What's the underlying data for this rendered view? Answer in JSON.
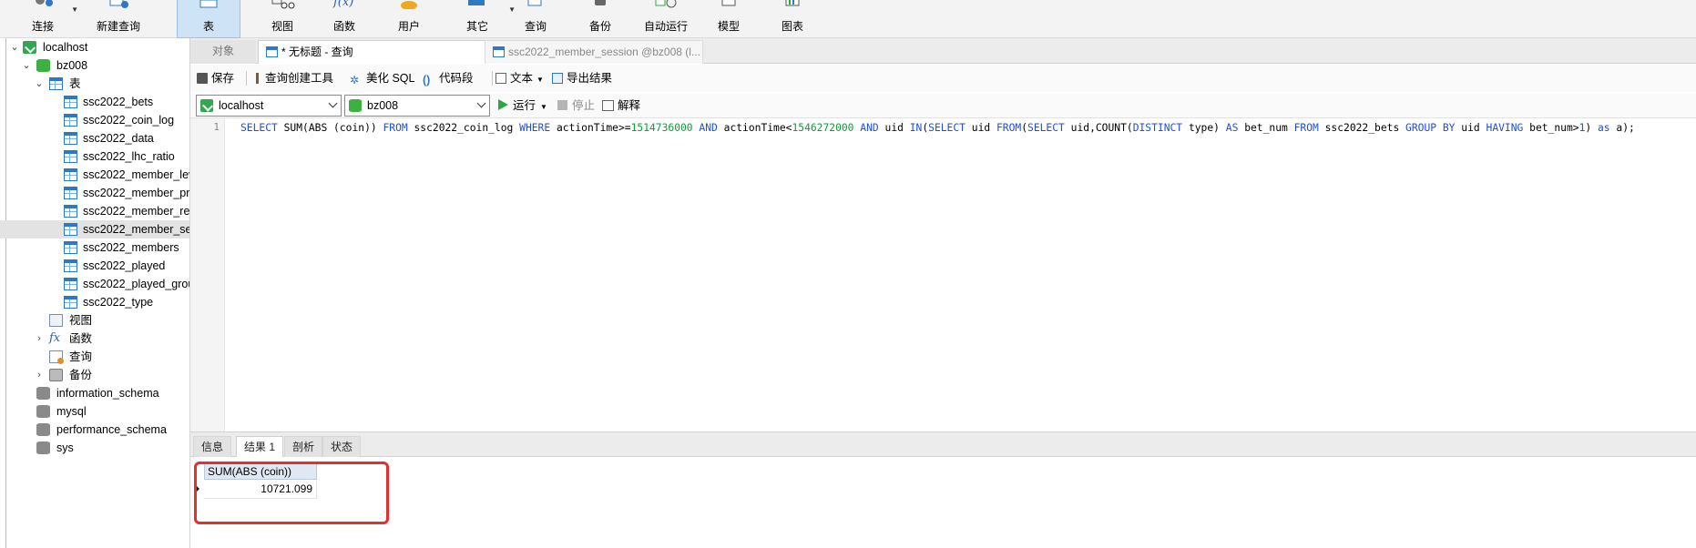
{
  "ribbon": {
    "items": [
      {
        "label": "连接",
        "icon": "plug-icon"
      },
      {
        "label": "新建查询",
        "icon": "new-query-icon"
      },
      {
        "label": "表",
        "icon": "table-icon"
      },
      {
        "label": "视图",
        "icon": "view-icon"
      },
      {
        "label": "函数",
        "icon": "function-icon"
      },
      {
        "label": "用户",
        "icon": "user-icon"
      },
      {
        "label": "其它",
        "icon": "other-icon"
      },
      {
        "label": "查询",
        "icon": "query-icon"
      },
      {
        "label": "备份",
        "icon": "backup-icon"
      },
      {
        "label": "自动运行",
        "icon": "schedule-icon"
      },
      {
        "label": "模型",
        "icon": "model-icon"
      },
      {
        "label": "图表",
        "icon": "chart-icon"
      }
    ],
    "active": "表"
  },
  "sidebar": {
    "connection": "localhost",
    "database": "bz008",
    "tables_folder": "表",
    "tables": [
      "ssc2022_bets",
      "ssc2022_coin_log",
      "ssc2022_data",
      "ssc2022_lhc_ratio",
      "ssc2022_member_lev",
      "ssc2022_member_pr",
      "ssc2022_member_re",
      "ssc2022_member_se",
      "ssc2022_members",
      "ssc2022_played",
      "ssc2022_played_grou",
      "ssc2022_type"
    ],
    "views_folder": "视图",
    "functions_folder": "函数",
    "queries_folder": "查询",
    "backups_folder": "备份",
    "other_databases": [
      "information_schema",
      "mysql",
      "performance_schema",
      "sys"
    ]
  },
  "tabs": {
    "objects": "对象",
    "query_tab": "* 无标题 - 查询",
    "session_tab": "ssc2022_member_session @bz008 (l..."
  },
  "toolbar": {
    "save": "保存",
    "query_builder": "查询创建工具",
    "beautify": "美化 SQL",
    "snippet": "代码段",
    "text": "文本",
    "export": "导出结果"
  },
  "selectors": {
    "connection": "localhost",
    "database": "bz008",
    "run": "运行",
    "stop": "停止",
    "explain": "解释"
  },
  "editor": {
    "line_number": "1",
    "sql": "SELECT SUM(ABS (coin)) FROM ssc2022_coin_log WHERE actionTime>=1514736000 AND actionTime<1546272000 AND uid IN(SELECT uid FROM(SELECT uid,COUNT(DISTINCT type) AS bet_num FROM ssc2022_bets GROUP BY uid HAVING bet_num>1) as a);"
  },
  "results": {
    "tabs": [
      "信息",
      "结果 1",
      "剖析",
      "状态"
    ],
    "active_tab": "结果 1",
    "column": "SUM(ABS (coin))",
    "value": "10721.099"
  },
  "colors": {
    "accent": "#cfe3f7",
    "keyword": "#1e4fd6",
    "number": "#0f9b3a",
    "highlight_box": "#e03030"
  }
}
